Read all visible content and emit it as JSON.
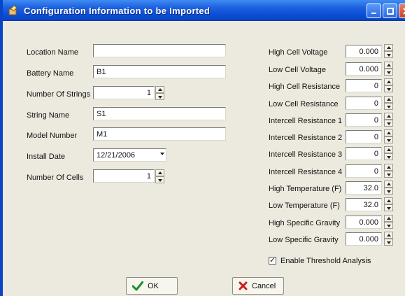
{
  "window": {
    "title": "Configuration Information to be Imported",
    "colors": {
      "titlebar": "#0b4fd6",
      "body": "#eceadf",
      "accent_ok": "#1f8f2a",
      "accent_cancel": "#cc1f1f"
    }
  },
  "left_form": {
    "location_name": {
      "label": "Location Name",
      "value": ""
    },
    "battery_name": {
      "label": "Battery Name",
      "value": "B1"
    },
    "number_of_strings": {
      "label": "Number Of Strings",
      "value": "1"
    },
    "string_name": {
      "label": "String Name",
      "value": "S1"
    },
    "model_number": {
      "label": "Model Number",
      "value": "M1"
    },
    "install_date": {
      "label": "Install Date",
      "value": "12/21/2006"
    },
    "number_of_cells": {
      "label": "Number Of Cells",
      "value": "1"
    }
  },
  "thresholds": [
    {
      "label": "High Cell Voltage",
      "value": "0.000"
    },
    {
      "label": "Low Cell Voltage",
      "value": "0.000"
    },
    {
      "label": "High Cell Resistance",
      "value": "0"
    },
    {
      "label": "Low Cell Resistance",
      "value": "0"
    },
    {
      "label": "Intercell Resistance 1",
      "value": "0"
    },
    {
      "label": "Intercell Resistance 2",
      "value": "0"
    },
    {
      "label": "Intercell Resistance 3",
      "value": "0"
    },
    {
      "label": "Intercell Resistance 4",
      "value": "0"
    },
    {
      "label": "High Temperature (F)",
      "value": "32.0"
    },
    {
      "label": "Low Temperature (F)",
      "value": "32.0"
    },
    {
      "label": "High Specific Gravity",
      "value": "0.000"
    },
    {
      "label": "Low Specific Gravity",
      "value": "0.000"
    }
  ],
  "enable_threshold": {
    "label": "Enable Threshold Analysis",
    "checked": true,
    "mark": "✓"
  },
  "buttons": {
    "ok": "OK",
    "cancel": "Cancel"
  },
  "icons": [
    "app-icon",
    "minimize-icon",
    "maximize-icon",
    "close-icon",
    "spin-up-icon",
    "spin-down-icon",
    "dropdown-arrow-icon",
    "checkmark-icon",
    "x-icon"
  ]
}
